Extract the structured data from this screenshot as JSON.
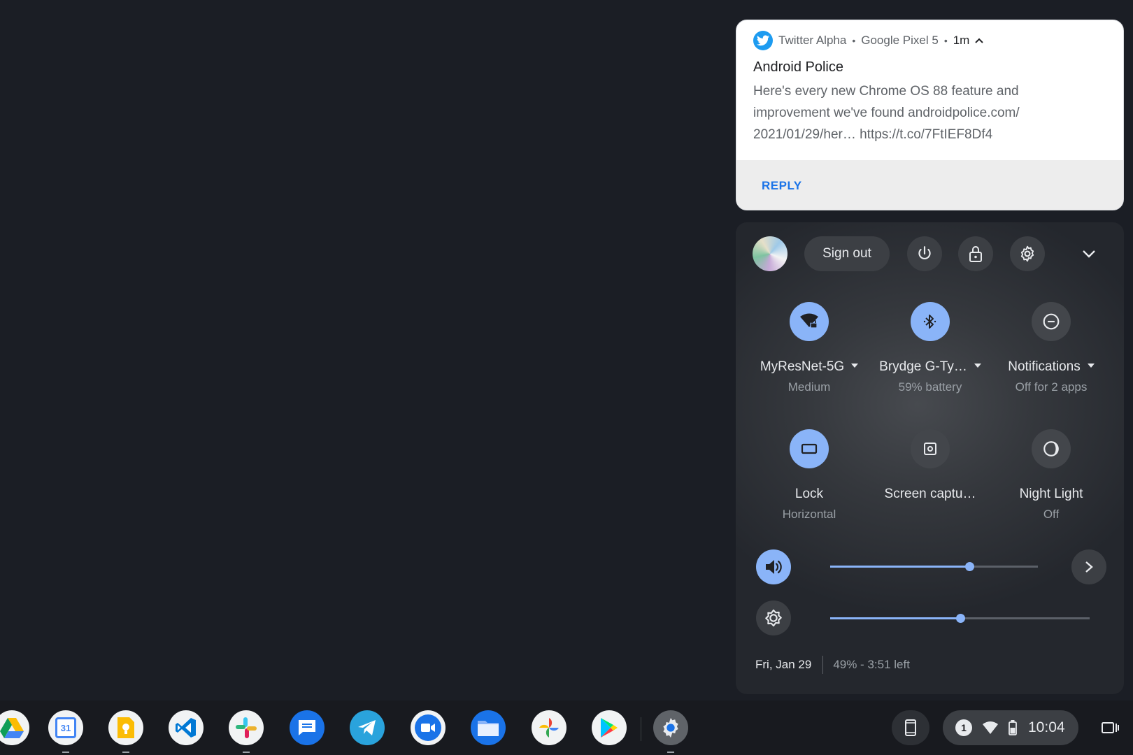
{
  "notification": {
    "app_name": "Twitter Alpha",
    "device": "Google Pixel 5",
    "time": "1m",
    "title": "Android Police",
    "body_lines": [
      "Here's every new Chrome OS 88 feature and",
      "improvement we've found androidpolice.com/",
      "2021/01/29/her… https://t.co/7FtIEF8Df4"
    ],
    "reply_label": "REPLY"
  },
  "quick_settings": {
    "sign_out_label": "Sign out",
    "tiles": [
      {
        "label": "MyResNet-5G",
        "sub": "Medium",
        "icon": "wifi-lock-icon",
        "state": "on",
        "has_menu": true
      },
      {
        "label": "Brydge G-Ty…",
        "sub": "59% battery",
        "icon": "bluetooth-icon",
        "state": "on",
        "has_menu": true
      },
      {
        "label": "Notifications",
        "sub": "Off for 2 apps",
        "icon": "do-not-disturb-icon",
        "state": "off",
        "has_menu": true
      },
      {
        "label": "Lock",
        "sub": "Horizontal",
        "icon": "rotation-lock-icon",
        "state": "on",
        "has_menu": false
      },
      {
        "label": "Screen captu…",
        "sub": "",
        "icon": "screen-capture-icon",
        "state": "off",
        "has_menu": false
      },
      {
        "label": "Night Light",
        "sub": "Off",
        "icon": "night-light-icon",
        "state": "off",
        "has_menu": false
      }
    ],
    "volume_level": 0.67,
    "brightness_level": 0.5,
    "date": "Fri, Jan 29",
    "battery": "49% - 3:51 left"
  },
  "shelf": {
    "apps": [
      "google-drive-icon",
      "google-calendar-icon",
      "google-keep-icon",
      "vscode-icon",
      "slack-icon",
      "messages-icon",
      "telegram-icon",
      "duo-icon",
      "files-icon",
      "google-photos-icon",
      "play-store-icon",
      "settings-icon"
    ],
    "calendar_day": "31",
    "notification_count": "1",
    "clock": "10:04"
  },
  "colors": {
    "accent": "#8ab4f8",
    "twitter": "#1d9bf0",
    "reply": "#1a73e8",
    "background": "#1b1e25"
  }
}
